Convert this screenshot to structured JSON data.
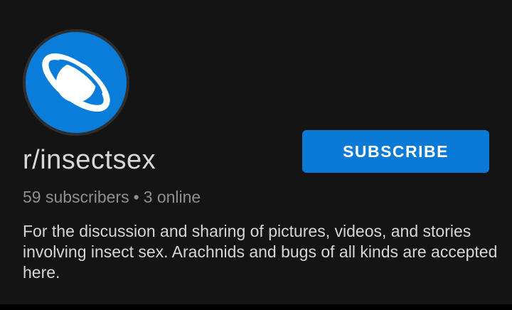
{
  "community": {
    "name": "r/insectsex",
    "subscribers": "59 subscribers",
    "separator": "•",
    "online": "3 online",
    "description": "For the discussion and sharing of pictures, videos, and stories involving insect sex. Arachnids and bugs of all kinds are accepted here.",
    "avatar_icon": "planet-icon"
  },
  "actions": {
    "subscribe_label": "SUBSCRIBE"
  },
  "colors": {
    "accent": "#0B7AD6",
    "background": "#141414",
    "text_primary": "#d8d8d8",
    "text_secondary": "#8f8f8f"
  }
}
